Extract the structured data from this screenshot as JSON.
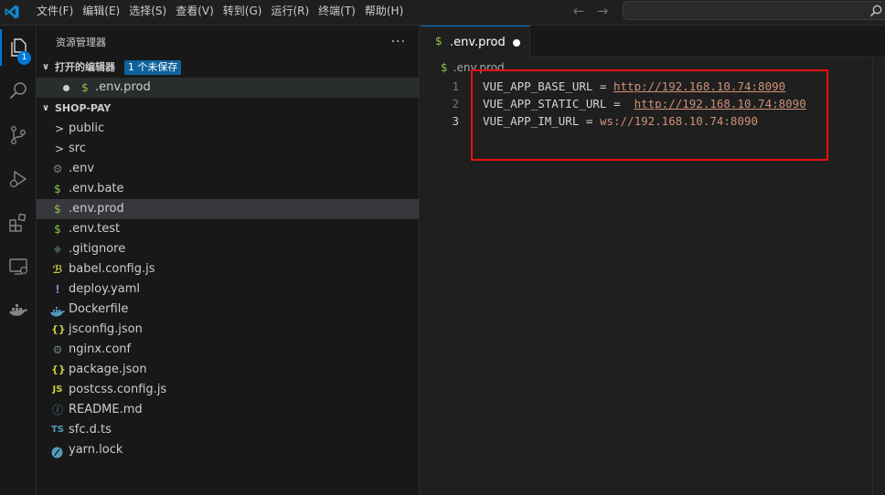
{
  "menu": [
    "文件(F)",
    "编辑(E)",
    "选择(S)",
    "查看(V)",
    "转到(G)",
    "运行(R)",
    "终端(T)",
    "帮助(H)"
  ],
  "activity": {
    "explorer_badge": "1"
  },
  "sidebar": {
    "title": "资源管理器",
    "more": "···",
    "open_editors": {
      "title": "打开的编辑器",
      "badge": "1 个未保存",
      "files": [
        {
          "name": ".env.prod",
          "icon": "$"
        }
      ]
    },
    "project": {
      "title": "SHOP-PAY",
      "items": [
        {
          "name": "public",
          "type": "folder",
          "icon": ">"
        },
        {
          "name": "src",
          "type": "folder",
          "icon": ">"
        },
        {
          "name": ".env",
          "icon": "⚙"
        },
        {
          "name": ".env.bate",
          "icon": "$"
        },
        {
          "name": ".env.prod",
          "icon": "$"
        },
        {
          "name": ".env.test",
          "icon": "$"
        },
        {
          "name": ".gitignore",
          "icon": "◆"
        },
        {
          "name": "babel.config.js",
          "icon": "ℬ"
        },
        {
          "name": "deploy.yaml",
          "icon": "!"
        },
        {
          "name": "Dockerfile",
          "icon": "docker"
        },
        {
          "name": "jsconfig.json",
          "icon": "{}"
        },
        {
          "name": "nginx.conf",
          "icon": "⚙"
        },
        {
          "name": "package.json",
          "icon": "{}"
        },
        {
          "name": "postcss.config.js",
          "icon": "JS"
        },
        {
          "name": "README.md",
          "icon": "ⓘ"
        },
        {
          "name": "sfc.d.ts",
          "icon": "TS"
        },
        {
          "name": "yarn.lock",
          "icon": "yarn"
        }
      ]
    }
  },
  "editor": {
    "tab": {
      "label": ".env.prod",
      "icon": "$"
    },
    "breadcrumb": ".env.prod",
    "lines": [
      {
        "num": "1",
        "key": "VUE_APP_BASE_URL",
        "eq": " = ",
        "value": "http://192.168.10.74:8090",
        "link": true
      },
      {
        "num": "2",
        "key": "VUE_APP_STATIC_URL",
        "eq": " =  ",
        "value": "http://192.168.10.74:8090",
        "link": true
      },
      {
        "num": "3",
        "key": "VUE_APP_IM_URL",
        "eq": " = ",
        "value": "ws://192.168.10.74:8090",
        "link": false
      }
    ]
  },
  "colors": {
    "accent": "#0078d4",
    "highlight_box": "#e81010",
    "env_icon": "#8dc149",
    "string": "#ce9178"
  }
}
